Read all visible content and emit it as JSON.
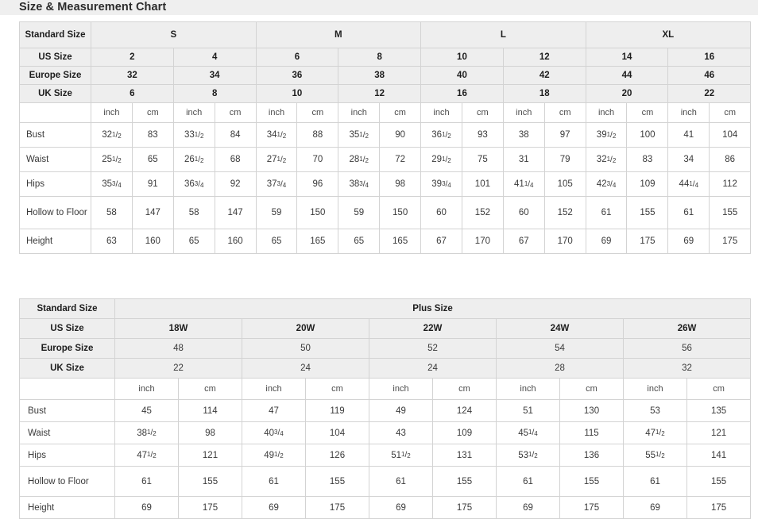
{
  "page": {
    "title": "Size & Measurement Chart",
    "background_color": "#ffffff",
    "title_band_color": "#efefef",
    "header_cell_color": "#eeeeee",
    "border_color": "#d3d3d3",
    "text_color": "#3a3a3a"
  },
  "chart_data": {
    "type": "table",
    "title": "Size & Measurement Chart",
    "tables": [
      {
        "name": "standard-size-table",
        "corner_label": "Standard Size",
        "size_groups": [
          {
            "label": "S",
            "columns": 2
          },
          {
            "label": "M",
            "columns": 2
          },
          {
            "label": "L",
            "columns": 2
          },
          {
            "label": "XL",
            "columns": 2
          }
        ],
        "size_rows": [
          {
            "label": "US Size",
            "values": [
              "2",
              "4",
              "6",
              "8",
              "10",
              "12",
              "14",
              "16"
            ]
          },
          {
            "label": "Europe Size",
            "values": [
              "32",
              "34",
              "36",
              "38",
              "40",
              "42",
              "44",
              "46"
            ]
          },
          {
            "label": "UK Size",
            "values": [
              "6",
              "8",
              "10",
              "12",
              "16",
              "18",
              "20",
              "22"
            ]
          }
        ],
        "unit_row": {
          "label": "",
          "units": [
            "inch",
            "cm",
            "inch",
            "cm",
            "inch",
            "cm",
            "inch",
            "cm",
            "inch",
            "cm",
            "inch",
            "cm",
            "inch",
            "cm",
            "inch",
            "cm"
          ]
        },
        "measurement_rows": [
          {
            "label": "Bust",
            "cells": [
              {
                "whole": "32",
                "num": "1",
                "den": "2"
              },
              {
                "whole": "83"
              },
              {
                "whole": "33",
                "num": "1",
                "den": "2"
              },
              {
                "whole": "84"
              },
              {
                "whole": "34",
                "num": "1",
                "den": "2"
              },
              {
                "whole": "88"
              },
              {
                "whole": "35",
                "num": "1",
                "den": "2"
              },
              {
                "whole": "90"
              },
              {
                "whole": "36",
                "num": "1",
                "den": "2"
              },
              {
                "whole": "93"
              },
              {
                "whole": "38"
              },
              {
                "whole": "97"
              },
              {
                "whole": "39",
                "num": "1",
                "den": "2"
              },
              {
                "whole": "100"
              },
              {
                "whole": "41"
              },
              {
                "whole": "104"
              }
            ]
          },
          {
            "label": "Waist",
            "cells": [
              {
                "whole": "25",
                "num": "1",
                "den": "2"
              },
              {
                "whole": "65"
              },
              {
                "whole": "26",
                "num": "1",
                "den": "2"
              },
              {
                "whole": "68"
              },
              {
                "whole": "27",
                "num": "1",
                "den": "2"
              },
              {
                "whole": "70"
              },
              {
                "whole": "28",
                "num": "1",
                "den": "2"
              },
              {
                "whole": "72"
              },
              {
                "whole": "29",
                "num": "1",
                "den": "2"
              },
              {
                "whole": "75"
              },
              {
                "whole": "31"
              },
              {
                "whole": "79"
              },
              {
                "whole": "32",
                "num": "1",
                "den": "2"
              },
              {
                "whole": "83"
              },
              {
                "whole": "34"
              },
              {
                "whole": "86"
              }
            ]
          },
          {
            "label": "Hips",
            "cells": [
              {
                "whole": "35",
                "num": "3",
                "den": "4"
              },
              {
                "whole": "91"
              },
              {
                "whole": "36",
                "num": "3",
                "den": "4"
              },
              {
                "whole": "92"
              },
              {
                "whole": "37",
                "num": "3",
                "den": "4"
              },
              {
                "whole": "96"
              },
              {
                "whole": "38",
                "num": "3",
                "den": "4"
              },
              {
                "whole": "98"
              },
              {
                "whole": "39",
                "num": "3",
                "den": "4"
              },
              {
                "whole": "101"
              },
              {
                "whole": "41",
                "num": "1",
                "den": "4"
              },
              {
                "whole": "105"
              },
              {
                "whole": "42",
                "num": "3",
                "den": "4"
              },
              {
                "whole": "109"
              },
              {
                "whole": "44",
                "num": "1",
                "den": "4"
              },
              {
                "whole": "112"
              }
            ]
          },
          {
            "label": "Hollow to Floor",
            "tall": true,
            "cells": [
              {
                "whole": "58"
              },
              {
                "whole": "147"
              },
              {
                "whole": "58"
              },
              {
                "whole": "147"
              },
              {
                "whole": "59"
              },
              {
                "whole": "150"
              },
              {
                "whole": "59"
              },
              {
                "whole": "150"
              },
              {
                "whole": "60"
              },
              {
                "whole": "152"
              },
              {
                "whole": "60"
              },
              {
                "whole": "152"
              },
              {
                "whole": "61"
              },
              {
                "whole": "155"
              },
              {
                "whole": "61"
              },
              {
                "whole": "155"
              }
            ]
          },
          {
            "label": "Height",
            "cells": [
              {
                "whole": "63"
              },
              {
                "whole": "160"
              },
              {
                "whole": "65"
              },
              {
                "whole": "160"
              },
              {
                "whole": "65"
              },
              {
                "whole": "165"
              },
              {
                "whole": "65"
              },
              {
                "whole": "165"
              },
              {
                "whole": "67"
              },
              {
                "whole": "170"
              },
              {
                "whole": "67"
              },
              {
                "whole": "170"
              },
              {
                "whole": "69"
              },
              {
                "whole": "175"
              },
              {
                "whole": "69"
              },
              {
                "whole": "175"
              }
            ]
          }
        ]
      },
      {
        "name": "plus-size-table",
        "corner_label": "Standard Size",
        "group_label": "Plus Size",
        "size_rows": [
          {
            "label": "US Size",
            "bold_values": true,
            "values": [
              "18W",
              "20W",
              "22W",
              "24W",
              "26W"
            ]
          },
          {
            "label": "Europe Size",
            "bold_values": false,
            "values": [
              "48",
              "50",
              "52",
              "54",
              "56"
            ]
          },
          {
            "label": "UK Size",
            "bold_values": false,
            "values": [
              "22",
              "24",
              "24",
              "28",
              "32"
            ]
          }
        ],
        "unit_row": {
          "label": "",
          "units": [
            "inch",
            "cm",
            "inch",
            "cm",
            "inch",
            "cm",
            "inch",
            "cm",
            "inch",
            "cm"
          ]
        },
        "measurement_rows": [
          {
            "label": "Bust",
            "cells": [
              {
                "whole": "45"
              },
              {
                "whole": "114"
              },
              {
                "whole": "47"
              },
              {
                "whole": "119"
              },
              {
                "whole": "49"
              },
              {
                "whole": "124"
              },
              {
                "whole": "51"
              },
              {
                "whole": "130"
              },
              {
                "whole": "53"
              },
              {
                "whole": "135"
              }
            ]
          },
          {
            "label": "Waist",
            "cells": [
              {
                "whole": "38",
                "num": "1",
                "den": "2"
              },
              {
                "whole": "98"
              },
              {
                "whole": "40",
                "num": "3",
                "den": "4"
              },
              {
                "whole": "104"
              },
              {
                "whole": "43"
              },
              {
                "whole": "109"
              },
              {
                "whole": "45",
                "num": "1",
                "den": "4"
              },
              {
                "whole": "115"
              },
              {
                "whole": "47",
                "num": "1",
                "den": "2"
              },
              {
                "whole": "121"
              }
            ]
          },
          {
            "label": "Hips",
            "cells": [
              {
                "whole": "47",
                "num": "1",
                "den": "2"
              },
              {
                "whole": "121"
              },
              {
                "whole": "49",
                "num": "1",
                "den": "2"
              },
              {
                "whole": "126"
              },
              {
                "whole": "51",
                "num": "1",
                "den": "2"
              },
              {
                "whole": "131"
              },
              {
                "whole": "53",
                "num": "1",
                "den": "2"
              },
              {
                "whole": "136"
              },
              {
                "whole": "55",
                "num": "1",
                "den": "2"
              },
              {
                "whole": "141"
              }
            ]
          },
          {
            "label": "Hollow to Floor",
            "tall": true,
            "cells": [
              {
                "whole": "61"
              },
              {
                "whole": "155"
              },
              {
                "whole": "61"
              },
              {
                "whole": "155"
              },
              {
                "whole": "61"
              },
              {
                "whole": "155"
              },
              {
                "whole": "61"
              },
              {
                "whole": "155"
              },
              {
                "whole": "61"
              },
              {
                "whole": "155"
              }
            ]
          },
          {
            "label": "Height",
            "cells": [
              {
                "whole": "69"
              },
              {
                "whole": "175"
              },
              {
                "whole": "69"
              },
              {
                "whole": "175"
              },
              {
                "whole": "69"
              },
              {
                "whole": "175"
              },
              {
                "whole": "69"
              },
              {
                "whole": "175"
              },
              {
                "whole": "69"
              },
              {
                "whole": "175"
              }
            ]
          }
        ]
      }
    ]
  }
}
